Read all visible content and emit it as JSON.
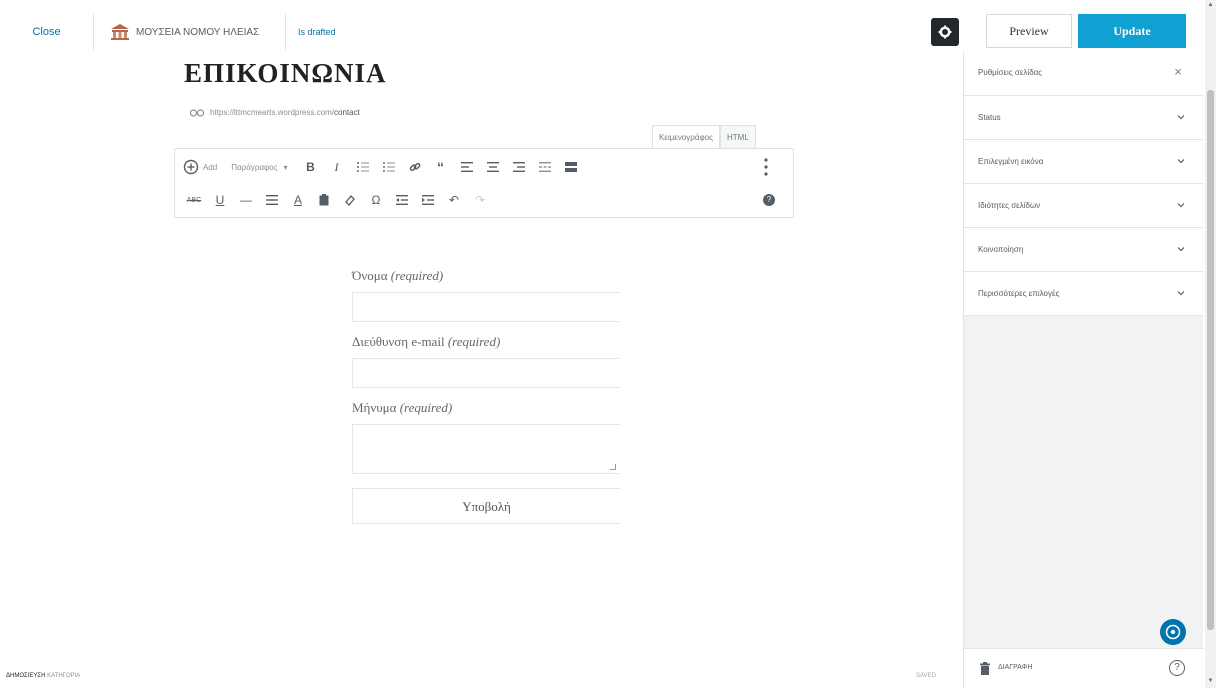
{
  "topbar": {
    "close_label": "Close",
    "site_name": "ΜΟΥΣΕΙΑ ΝΟΜΟΥ ΗΛΕΙΑΣ",
    "draft_label": "Is drafted",
    "preview_label": "Preview",
    "update_label": "Update"
  },
  "editor": {
    "title": "ΕΠΙΚΟΙΝΩΝΙΑ",
    "permalink_base": "https://lttmcmearts.wordpress.com/",
    "permalink_slug": "contact",
    "tabs": [
      {
        "label": "Κειμενογράφος",
        "active": true
      },
      {
        "label": "HTML",
        "active": false
      }
    ],
    "add_label": "Add",
    "format_label": "Παράγραφος"
  },
  "form": {
    "name_label": "Όνομα",
    "email_label": "Διεύθυνση e-mail",
    "message_label": "Μήνυμα",
    "required_suffix": "(required)",
    "submit_label": "Υποβολή"
  },
  "sidebar": {
    "header": "Ρυθμίσεις σελίδας",
    "panels": [
      {
        "label": "Status"
      },
      {
        "label": "Επιλεγμένη εικόνα"
      },
      {
        "label": "Ιδιότητες σελίδων"
      },
      {
        "label": "Κοινοποίηση"
      },
      {
        "label": "Περισσότερες επιλογές"
      }
    ],
    "delete_label": "ΔΙΑΓΡΑΦΗ"
  },
  "footer": {
    "breadcrumb": "ΔΗΜΟΣΙΕΥΣΗ",
    "breadcrumb_rest": "ΚΑΤΗΓΟΡΙΑ",
    "status": "SAVED"
  },
  "colors": {
    "accent": "#11a0d2",
    "link": "#0073aa",
    "dark": "#23282d",
    "sidebar_bg": "#f1f2f3"
  }
}
